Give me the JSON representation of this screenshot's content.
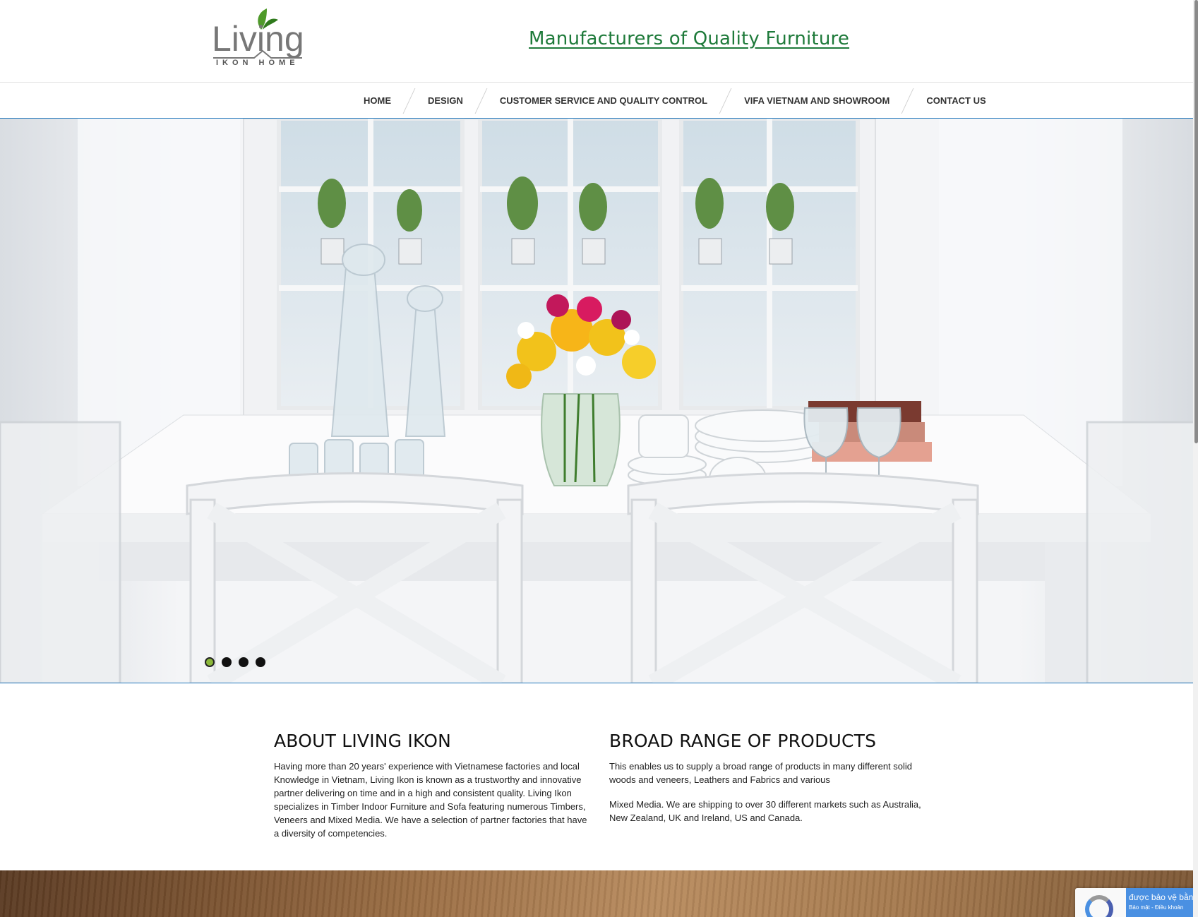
{
  "header": {
    "logo": {
      "word": "Living",
      "subtitle": "IKON HOME",
      "leaf_color": "#5aa02c"
    },
    "tagline": "Manufacturers of Quality Furniture",
    "tagline_color": "#1e7a3a"
  },
  "nav": {
    "items": [
      {
        "label": "HOME"
      },
      {
        "label": "DESIGN"
      },
      {
        "label": "CUSTOMER SERVICE AND QUALITY CONTROL"
      },
      {
        "label": "VIFA VIETNAM AND SHOWROOM"
      },
      {
        "label": "CONTACT US"
      }
    ],
    "accent": "#2277bb"
  },
  "hero": {
    "image": "white dining table with vase of yellow and pink flowers, glassware, plates and cross-back chairs in front of glass cabinet",
    "slides": 4,
    "active_slide": 1,
    "active_dot_color": "#8cb83a"
  },
  "about": {
    "title": "ABOUT LIVING IKON",
    "body": "Having more than 20 years' experience with Vietnamese factories and local Knowledge in Vietnam, Living Ikon is known as a trustworthy and innovative partner delivering on time and in a high and consistent quality. Living Ikon specializes in Timber Indoor Furniture and Sofa featuring numerous Timbers, Veneers and Mixed Media. We have a selection of partner factories that have a diversity of competencies."
  },
  "products": {
    "title": "BROAD RANGE OF PRODUCTS",
    "paragraph1": "This enables us to supply a broad range of products in many different solid woods and veneers, Leathers and Fabrics and various",
    "paragraph2": "Mixed Media. We are shipping to over 30 different markets such as Australia, New Zealand, UK and Ireland, US and Canada."
  },
  "captcha": {
    "line1": "được bảo vệ bằng",
    "line2": "Bảo mật - Điều khoản"
  }
}
